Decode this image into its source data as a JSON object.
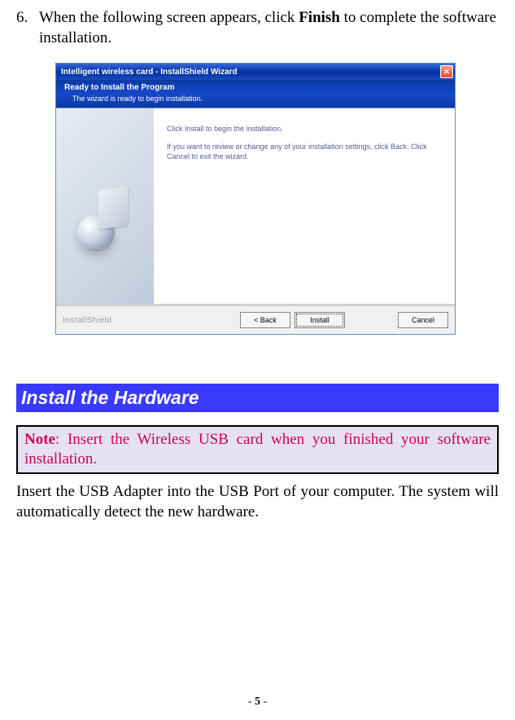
{
  "step": {
    "number": "6.",
    "text_pre": "When the following screen appears, click ",
    "text_bold": "Finish",
    "text_post": " to complete the software installation."
  },
  "installer": {
    "title": "Intelligent wireless card - InstallShield Wizard",
    "ready": "Ready to Install the Program",
    "subtitle": "The wizard is ready to begin installation.",
    "line1": "Click Install to begin the installation.",
    "line2": "If you want to review or change any of your installation settings, click Back. Click Cancel to exit the wizard.",
    "brand": "InstallShield",
    "btn_back": "< Back",
    "btn_install": "Install",
    "btn_cancel": "Cancel"
  },
  "section_heading": "Install the Hardware",
  "note": {
    "label": "Note",
    "text": ": Insert the Wireless USB card when you finished your software installation."
  },
  "body": "Insert the USB Adapter into the USB Port of your computer. The system will automatically detect the new hardware.",
  "page_number": "- 5 -"
}
